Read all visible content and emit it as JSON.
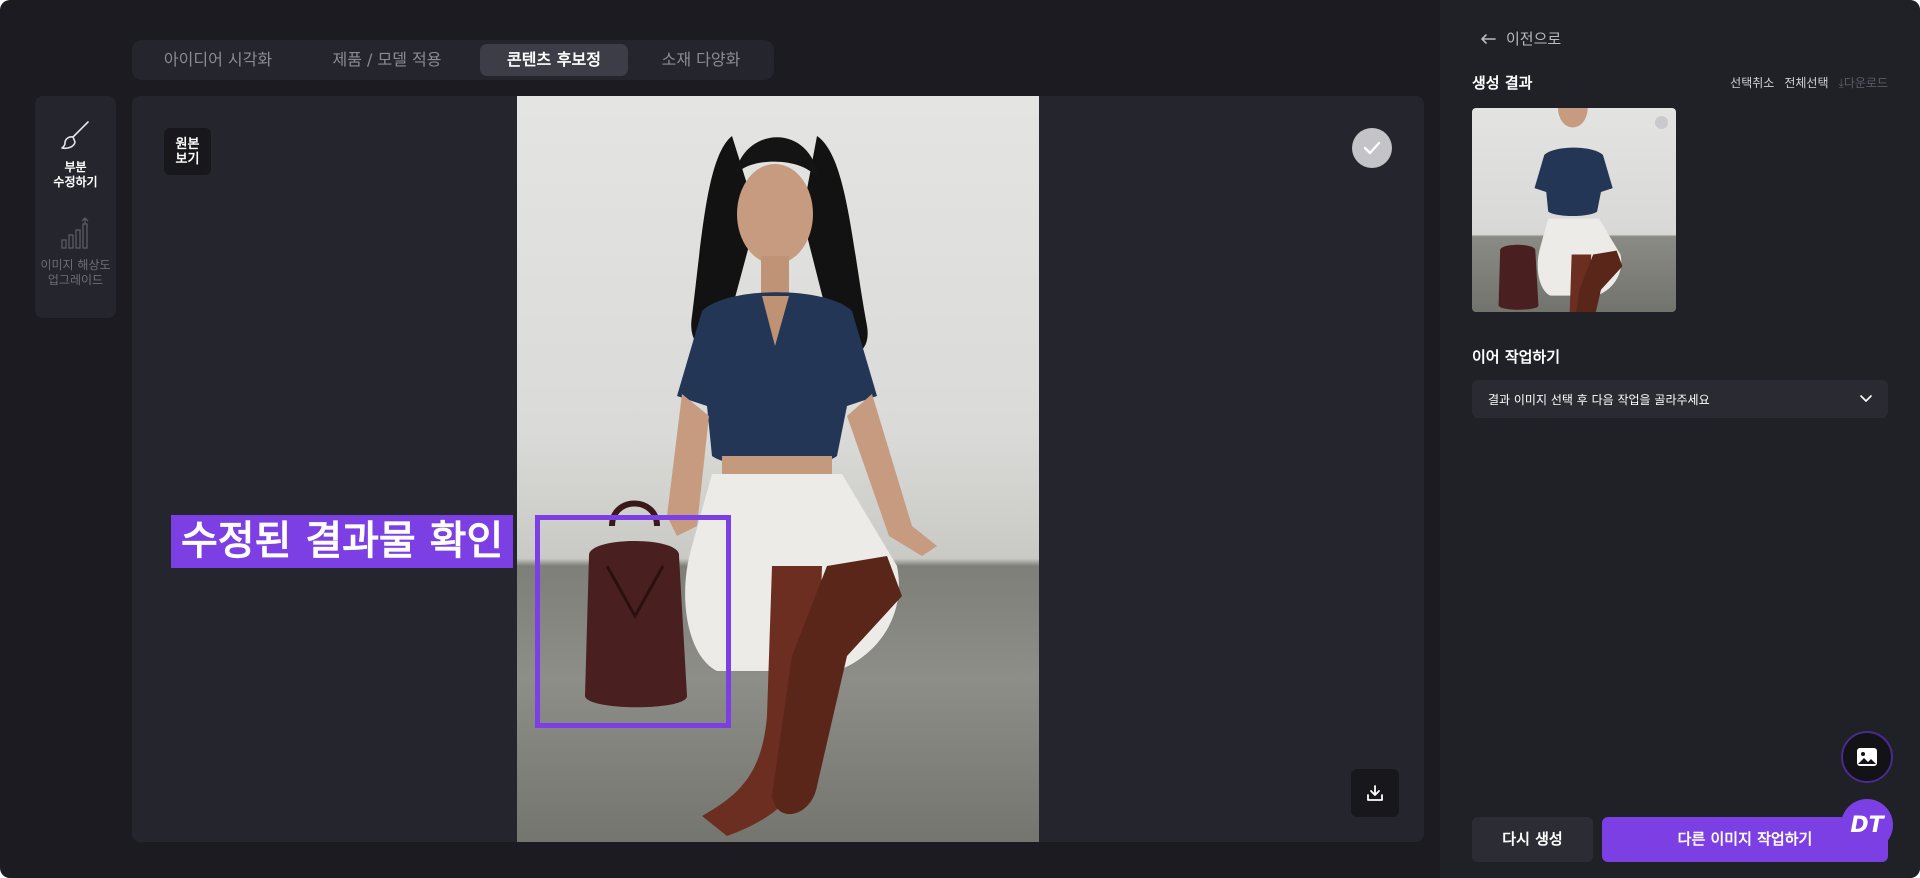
{
  "tabs": [
    {
      "label": "아이디어 시각화"
    },
    {
      "label": "제품 / 모델 적용"
    },
    {
      "label": "콘텐츠 후보정"
    },
    {
      "label": "소재 다양화"
    }
  ],
  "active_tab": "콘텐츠 후보정",
  "toolbar": {
    "tools": [
      {
        "label": "부분\n수정하기",
        "icon": "brush-icon",
        "state": "active"
      },
      {
        "label": "이미지 해상도\n업그레이드",
        "icon": "upscale-bars-icon",
        "state": "disabled"
      }
    ]
  },
  "canvas": {
    "original_view_label": "원본\n보기",
    "selected_icon": "check-icon",
    "download_icon": "download-icon",
    "annotation_label": "수정된 결과물 확인"
  },
  "panel": {
    "back_label": "이전으로",
    "results_title": "생성 결과",
    "deselect_label": "선택취소",
    "select_all_label": "전체선택",
    "download_label": "다운로드",
    "continue_title": "이어 작업하기",
    "select_placeholder": "결과 이미지 선택 후 다음 작업을 골라주세요",
    "regenerate_label": "다시 생성",
    "other_image_label": "다른 이미지 작업하기",
    "badge_label": "DT"
  },
  "colors": {
    "accent": "#7b3fe4",
    "background": "#1b1b21",
    "panel": "#202027",
    "surface": "#25252d"
  }
}
